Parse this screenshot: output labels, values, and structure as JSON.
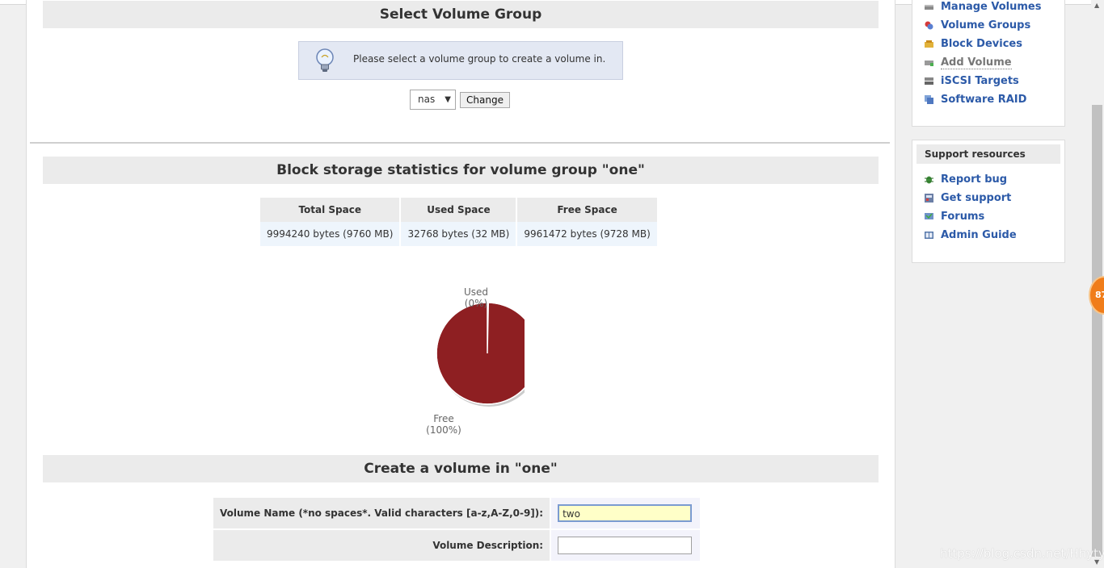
{
  "select_group": {
    "title": "Select Volume Group",
    "info_text": "Please select a volume group to create a volume in.",
    "selected_value": "nas",
    "change_label": "Change"
  },
  "stats": {
    "title": "Block storage statistics for volume group \"one\"",
    "headers": [
      "Total Space",
      "Used Space",
      "Free Space"
    ],
    "values": [
      "9994240 bytes (9760 MB)",
      "32768 bytes (32 MB)",
      "9961472 bytes (9728 MB)"
    ]
  },
  "chart_data": {
    "type": "pie",
    "slices": [
      {
        "label": "Used",
        "percent_label": "(0%)",
        "value": 32768,
        "color": "#ffffff"
      },
      {
        "label": "Free",
        "percent_label": "(100%)",
        "value": 9961472,
        "color": "#8e1f22"
      }
    ]
  },
  "create": {
    "title": "Create a volume in \"one\"",
    "name_label": "Volume Name (*no spaces*. Valid characters [a-z,A-Z,0-9]):",
    "name_value": "two",
    "desc_label": "Volume Description:",
    "desc_value": ""
  },
  "sidebar": {
    "volume_links": [
      {
        "label": "Manage Volumes",
        "icon": "manage-volumes-icon"
      },
      {
        "label": "Volume Groups",
        "icon": "volume-groups-icon"
      },
      {
        "label": "Block Devices",
        "icon": "block-devices-icon"
      },
      {
        "label": "Add Volume",
        "icon": "add-volume-icon"
      },
      {
        "label": "iSCSI Targets",
        "icon": "iscsi-targets-icon"
      },
      {
        "label": "Software RAID",
        "icon": "software-raid-icon"
      }
    ],
    "support_title": "Support resources",
    "support_links": [
      {
        "label": "Report bug",
        "icon": "bug-icon"
      },
      {
        "label": "Get support",
        "icon": "support-icon"
      },
      {
        "label": "Forums",
        "icon": "forums-icon"
      },
      {
        "label": "Admin Guide",
        "icon": "book-icon"
      }
    ]
  },
  "badge_text": "87",
  "watermark": "https://blog.csdn.net/Hhytyt",
  "colors": {
    "link": "#2c5aa8",
    "pie_free": "#8e1f22",
    "badge": "#f07d1a"
  }
}
